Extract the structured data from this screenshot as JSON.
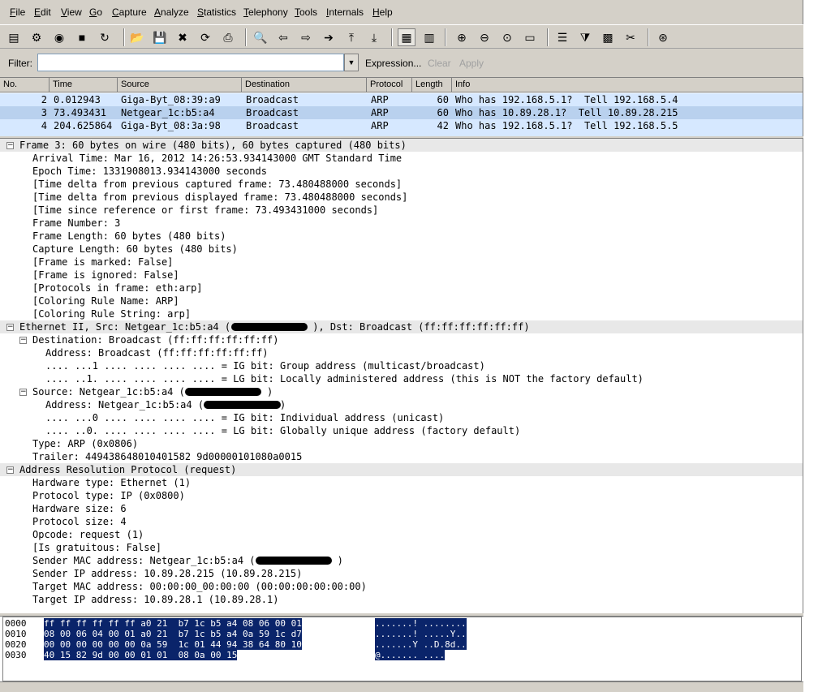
{
  "menu": [
    "File",
    "Edit",
    "View",
    "Go",
    "Capture",
    "Analyze",
    "Statistics",
    "Telephony",
    "Tools",
    "Internals",
    "Help"
  ],
  "toolbar": {
    "icons": [
      {
        "name": "interface-list-icon",
        "glyph": "▤"
      },
      {
        "name": "capture-options-icon",
        "glyph": "⚙"
      },
      {
        "name": "start-capture-icon",
        "glyph": "◉"
      },
      {
        "name": "stop-capture-icon",
        "glyph": "■"
      },
      {
        "name": "restart-capture-icon",
        "glyph": "↻"
      },
      {
        "name": "open-file-icon",
        "glyph": "📂"
      },
      {
        "name": "save-file-icon",
        "glyph": "💾"
      },
      {
        "name": "close-file-icon",
        "glyph": "✖"
      },
      {
        "name": "reload-icon",
        "glyph": "⟳"
      },
      {
        "name": "print-icon",
        "glyph": "⎙"
      },
      {
        "name": "find-packet-icon",
        "glyph": "🔍"
      },
      {
        "name": "go-back-icon",
        "glyph": "⇦"
      },
      {
        "name": "go-forward-icon",
        "glyph": "⇨"
      },
      {
        "name": "go-to-packet-icon",
        "glyph": "➔"
      },
      {
        "name": "first-packet-icon",
        "glyph": "⤒"
      },
      {
        "name": "last-packet-icon",
        "glyph": "⤓"
      },
      {
        "name": "colorize-icon",
        "glyph": "▦"
      },
      {
        "name": "auto-scroll-icon",
        "glyph": "▥"
      },
      {
        "name": "zoom-in-icon",
        "glyph": "⊕"
      },
      {
        "name": "zoom-out-icon",
        "glyph": "⊖"
      },
      {
        "name": "normal-size-icon",
        "glyph": "⊙"
      },
      {
        "name": "resize-columns-icon",
        "glyph": "▭"
      },
      {
        "name": "capture-filters-icon",
        "glyph": "☰"
      },
      {
        "name": "display-filters-icon",
        "glyph": "⧩"
      },
      {
        "name": "coloring-rules-icon",
        "glyph": "▩"
      },
      {
        "name": "preferences-icon",
        "glyph": "✂"
      },
      {
        "name": "help-icon",
        "glyph": "⊛"
      }
    ]
  },
  "filter": {
    "label": "Filter:",
    "value": "",
    "expression": "Expression...",
    "clear": "Clear",
    "apply": "Apply"
  },
  "packet_list": {
    "columns": [
      "No.",
      "Time",
      "Source",
      "Destination",
      "Protocol",
      "Length",
      "Info"
    ],
    "rows": [
      {
        "no": "2",
        "time": "0.012943",
        "src": "Giga-Byt_08:39:a9",
        "dst": "Broadcast",
        "proto": "ARP",
        "len": "60",
        "info": "Who has 192.168.5.1?  Tell 192.168.5.4"
      },
      {
        "no": "3",
        "time": "73.493431",
        "src": "Netgear_1c:b5:a4",
        "dst": "Broadcast",
        "proto": "ARP",
        "len": "60",
        "info": "Who has 10.89.28.1?  Tell 10.89.28.215"
      },
      {
        "no": "4",
        "time": "204.625864",
        "src": "Giga-Byt_08:3a:98",
        "dst": "Broadcast",
        "proto": "ARP",
        "len": "42",
        "info": "Who has 192.168.5.1?  Tell 192.168.5.5"
      }
    ]
  },
  "detail": [
    {
      "text": "Frame 3: 60 bytes on wire (480 bits), 60 bytes captured (480 bits)",
      "indent": 0,
      "expander": "-",
      "header": true
    },
    {
      "text": "Arrival Time: Mar 16, 2012 14:26:53.934143000 GMT Standard Time",
      "indent": 1
    },
    {
      "text": "Epoch Time: 1331908013.934143000 seconds",
      "indent": 1
    },
    {
      "text": "[Time delta from previous captured frame: 73.480488000 seconds]",
      "indent": 1
    },
    {
      "text": "[Time delta from previous displayed frame: 73.480488000 seconds]",
      "indent": 1
    },
    {
      "text": "[Time since reference or first frame: 73.493431000 seconds]",
      "indent": 1
    },
    {
      "text": "Frame Number: 3",
      "indent": 1
    },
    {
      "text": "Frame Length: 60 bytes (480 bits)",
      "indent": 1
    },
    {
      "text": "Capture Length: 60 bytes (480 bits)",
      "indent": 1
    },
    {
      "text": "[Frame is marked: False]",
      "indent": 1
    },
    {
      "text": "[Frame is ignored: False]",
      "indent": 1
    },
    {
      "text": "[Protocols in frame: eth:arp]",
      "indent": 1
    },
    {
      "text": "[Coloring Rule Name: ARP]",
      "indent": 1
    },
    {
      "text": "[Coloring Rule String: arp]",
      "indent": 1
    },
    {
      "text": "Ethernet II, Src: Netgear_1c:b5:a4 (              ), Dst: Broadcast (ff:ff:ff:ff:ff:ff)",
      "indent": 0,
      "expander": "-",
      "header": true,
      "redact": true
    },
    {
      "text": "Destination: Broadcast (ff:ff:ff:ff:ff:ff)",
      "indent": 1,
      "expander": "-"
    },
    {
      "text": "Address: Broadcast (ff:ff:ff:ff:ff:ff)",
      "indent": 2
    },
    {
      "text": ".... ...1 .... .... .... .... = IG bit: Group address (multicast/broadcast)",
      "indent": 2
    },
    {
      "text": ".... ..1. .... .... .... .... = LG bit: Locally administered address (this is NOT the factory default)",
      "indent": 2
    },
    {
      "text": "Source: Netgear_1c:b5:a4 (              )",
      "indent": 1,
      "expander": "-",
      "redact": true
    },
    {
      "text": "Address: Netgear_1c:b5:a4 (             )",
      "indent": 2,
      "redact": true
    },
    {
      "text": ".... ...0 .... .... .... .... = IG bit: Individual address (unicast)",
      "indent": 2
    },
    {
      "text": ".... ..0. .... .... .... .... = LG bit: Globally unique address (factory default)",
      "indent": 2
    },
    {
      "text": "Type: ARP (0x0806)",
      "indent": 1
    },
    {
      "text": "Trailer: 449438648010401582 9d00000101080a0015",
      "indent": 1
    },
    {
      "text": "Address Resolution Protocol (request)",
      "indent": 0,
      "expander": "-",
      "header": true
    },
    {
      "text": "Hardware type: Ethernet (1)",
      "indent": 1
    },
    {
      "text": "Protocol type: IP (0x0800)",
      "indent": 1
    },
    {
      "text": "Hardware size: 6",
      "indent": 1
    },
    {
      "text": "Protocol size: 4",
      "indent": 1
    },
    {
      "text": "Opcode: request (1)",
      "indent": 1
    },
    {
      "text": "[Is gratuitous: False]",
      "indent": 1
    },
    {
      "text": "Sender MAC address: Netgear_1c:b5:a4 (              )",
      "indent": 1,
      "redact": true
    },
    {
      "text": "Sender IP address: 10.89.28.215 (10.89.28.215)",
      "indent": 1
    },
    {
      "text": "Target MAC address: 00:00:00_00:00:00 (00:00:00:00:00:00)",
      "indent": 1
    },
    {
      "text": "Target IP address: 10.89.28.1 (10.89.28.1)",
      "indent": 1
    }
  ],
  "hex": [
    {
      "off": "0000",
      "hex": "ff ff ff ff ff ff a0 21  b7 1c b5 a4 08 06 00 01",
      "ascii": ".......! ........"
    },
    {
      "off": "0010",
      "hex": "08 00 06 04 00 01 a0 21  b7 1c b5 a4 0a 59 1c d7",
      "ascii": ".......! .....Y.."
    },
    {
      "off": "0020",
      "hex": "00 00 00 00 00 00 0a 59  1c 01 44 94 38 64 80 10",
      "ascii": ".......Y ..D.8d.."
    },
    {
      "off": "0030",
      "hex": "40 15 82 9d 00 00 01 01  08 0a 00 15",
      "ascii": "@....... ...."
    }
  ]
}
